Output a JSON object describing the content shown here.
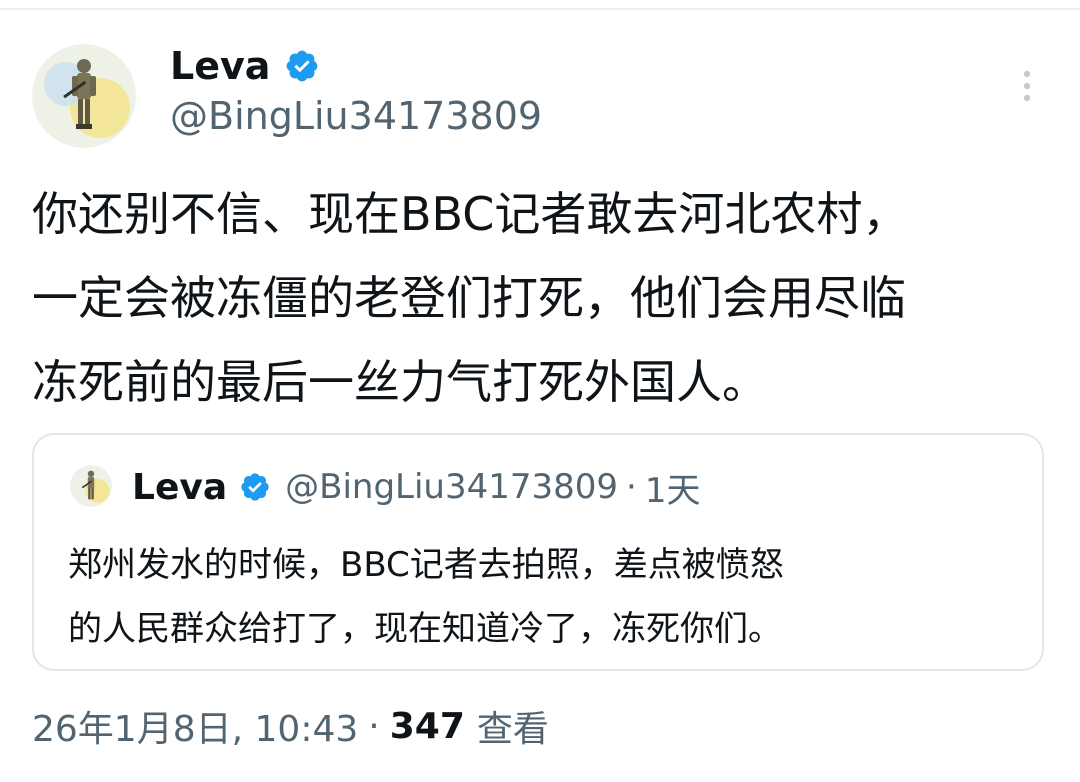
{
  "colors": {
    "verified_blue": "#1d9bf0",
    "secondary_text": "#536471",
    "primary_text": "#0f1419",
    "border": "#e1e6ea"
  },
  "tweet": {
    "author": {
      "display_name": "Leva",
      "handle": "@BingLiu34173809",
      "avatar_icon": "soldier-avatar",
      "verified_icon": "verified-badge-icon"
    },
    "more_icon": "more-vertical-icon",
    "text": "你还别不信、现在BBC记者敢去河北农村，\n一定会被冻僵的老登们打死，他们会用尽临\n冻死前的最后一丝力气打死外国人。",
    "quoted": {
      "display_name": "Leva",
      "handle": "@BingLiu34173809",
      "separator": "·",
      "time": "1天",
      "text": "郑州发水的时候，BBC记者去拍照，差点被愤怒\n的人民群众给打了，现在知道冷了，冻死你们。"
    },
    "meta": {
      "timestamp": "26年1月8日, 10:43",
      "separator": "·",
      "views": "347",
      "views_label": "查看"
    }
  }
}
